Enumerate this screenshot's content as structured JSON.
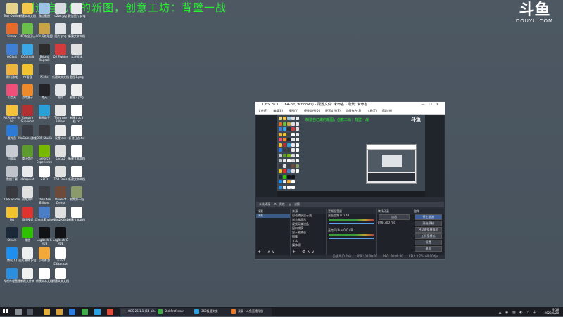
{
  "banner": "制造自己做的新图，创意工坊：背壁一战",
  "watermark": {
    "logo": "斗鱼",
    "site": "DOUYU.COM"
  },
  "desktop_icons": [
    {
      "label": "Tray Outline",
      "col": 0,
      "color": "#e8d38a"
    },
    {
      "label": "新建文本文档",
      "col": 1,
      "color": "#f4c84a"
    },
    {
      "label": "微信截图",
      "col": 2,
      "color": "#9cc3e6"
    },
    {
      "label": "u2bc.jpg",
      "col": 3,
      "color": "#d9dde2"
    },
    {
      "label": "微信图片.png",
      "col": 4,
      "color": "#e9eaec"
    },
    {
      "label": "Firefox",
      "col": 0,
      "color": "#e66a2c"
    },
    {
      "label": "360安全卫士",
      "col": 1,
      "color": "#6cc04a"
    },
    {
      "label": "LOL英雄联盟",
      "col": 2,
      "color": "#c9a34a"
    },
    {
      "label": "图片.png",
      "col": 3,
      "color": "#dfe3e7"
    },
    {
      "label": "新建文本文档",
      "col": 4,
      "color": "#e9eaec"
    },
    {
      "label": "QQ游戏",
      "col": 0,
      "color": "#3f7fd6"
    },
    {
      "label": "QQ浏览器",
      "col": 1,
      "color": "#3aa7e6"
    },
    {
      "label": "Bright Ragdoll",
      "col": 2,
      "color": "#2d2d2d"
    },
    {
      "label": "Q2 Fighter",
      "col": 3,
      "color": "#d23c3c"
    },
    {
      "label": "实况足球",
      "col": 4,
      "color": "#e0e0e0"
    },
    {
      "label": "腾讯游戏",
      "col": 0,
      "color": "#f0b43c"
    },
    {
      "label": "YY语音",
      "col": 1,
      "color": "#f2c230"
    },
    {
      "label": "Niche",
      "col": 2,
      "color": "#3a3f48"
    },
    {
      "label": "新建文本文档",
      "col": 3,
      "color": "#ffffff"
    },
    {
      "label": "截图1.png",
      "col": 4,
      "color": "#e8ecef"
    },
    {
      "label": "钉工具",
      "col": 0,
      "color": "#f04f7a"
    },
    {
      "label": "游戏盒子",
      "col": 1,
      "color": "#ef8a2a"
    },
    {
      "label": "冬天",
      "col": 2,
      "color": "#222428"
    },
    {
      "label": "图片",
      "col": 3,
      "color": "#e3e6e9"
    },
    {
      "label": "截图2.png",
      "col": 4,
      "color": "#f0f0f0"
    },
    {
      "label": "PotPlayer 64 bit",
      "col": 0,
      "color": "#f5c23a"
    },
    {
      "label": "Vampire Survivors",
      "col": 1,
      "color": "#b33030"
    },
    {
      "label": "截图助手",
      "col": 2,
      "color": "#2aa0d8"
    },
    {
      "label": "They Are Billions",
      "col": 3,
      "color": "#e6e6e6"
    },
    {
      "label": "新建文本文档.txt",
      "col": 4,
      "color": "#ffffff"
    },
    {
      "label": "夏令营",
      "col": 0,
      "color": "#2c7ad6"
    },
    {
      "label": "MaGame游戏",
      "col": 1,
      "color": "#3a3c44"
    },
    {
      "label": "OBS Studio",
      "col": 2,
      "color": "#383a40"
    },
    {
      "label": "设置.exe",
      "col": 3,
      "color": "#eaeaea"
    },
    {
      "label": "新建日志.txt",
      "col": 4,
      "color": "#ffffff"
    },
    {
      "label": "回收站",
      "col": 0,
      "color": "#c8ccd2"
    },
    {
      "label": "腾讯会议",
      "col": 1,
      "color": "#5c9c2c"
    },
    {
      "label": "GeForce Experience",
      "col": 2,
      "color": "#76b900"
    },
    {
      "label": "CS:GO",
      "col": 3,
      "color": "#e0e0e0"
    },
    {
      "label": "新建文本文档",
      "col": 4,
      "color": "#ffffff"
    },
    {
      "label": "数据下载",
      "col": 0,
      "color": "#c0c4ca"
    },
    {
      "label": "datapoint",
      "col": 1,
      "color": "#e9eaec"
    },
    {
      "label": "21FR",
      "col": 2,
      "color": "#ffffff"
    },
    {
      "label": "TAB Tools",
      "col": 3,
      "color": "#e2e2e2"
    },
    {
      "label": "新建文本文档",
      "col": 4,
      "color": "#ffffff"
    },
    {
      "label": "OBS Studio",
      "col": 0,
      "color": "#383a40"
    },
    {
      "label": "视频文件",
      "col": 1,
      "color": "#e0e0e0"
    },
    {
      "label": "They Are Billions",
      "col": 2,
      "color": "#3d3f47"
    },
    {
      "label": "Dawn of Demo",
      "col": 3,
      "color": "#6d4a3a"
    },
    {
      "label": "视频第一段",
      "col": 4,
      "color": "#8a9a6a"
    },
    {
      "label": "QQ",
      "col": 0,
      "color": "#f2c12e"
    },
    {
      "label": "腾讯视频",
      "col": 1,
      "color": "#e0332f"
    },
    {
      "label": "Cheat Engine",
      "col": 2,
      "color": "#4c7ec7"
    },
    {
      "label": "NBA2K游戏",
      "col": 3,
      "color": "#e0e0e0"
    },
    {
      "label": "新建文本文档",
      "col": 4,
      "color": "#ffffff"
    },
    {
      "label": "Steam",
      "col": 0,
      "color": "#1b2838"
    },
    {
      "label": "微信",
      "col": 1,
      "color": "#2dc100"
    },
    {
      "label": "Logitech G HUB",
      "col": 2,
      "color": "#101215"
    },
    {
      "label": "Logitech G HUB",
      "col": 3,
      "color": "#101215"
    },
    {
      "label": "",
      "col": 4,
      "color": "transparent"
    },
    {
      "label": "腾讯QQ",
      "col": 0,
      "color": "#1e8ef0"
    },
    {
      "label": "图片编辑.png",
      "col": 1,
      "color": "#eceef0"
    },
    {
      "label": "小电影游",
      "col": 2,
      "color": "#f3a93a"
    },
    {
      "label": "Launch Editor.bat",
      "col": 3,
      "color": "#ffffff"
    },
    {
      "label": "",
      "col": 4,
      "color": "transparent"
    },
    {
      "label": "哔哩哔哩直播",
      "col": 0,
      "color": "#2a8fe0"
    },
    {
      "label": "新建文件夹",
      "col": 1,
      "color": "#f0f0f0"
    },
    {
      "label": "新建文本文档",
      "col": 2,
      "color": "#ffffff"
    },
    {
      "label": "新建文本文档",
      "col": 3,
      "color": "#ffffff"
    },
    {
      "label": "",
      "col": 4,
      "color": "transparent"
    }
  ],
  "obs": {
    "title": "OBS 26.1.1 (64-bit, windows) - 配置文件: 未命名 - 场景: 未命名",
    "menu": [
      "文件(F)",
      "编辑(E)",
      "视图(V)",
      "停靠部件(D)",
      "配置文件(P)",
      "场景集合(S)",
      "工具(T)",
      "帮助(H)"
    ],
    "preview_banner": "制造自己做的新图，创意工坊：背壁一战",
    "preview_watermark": "斗鱼",
    "no_source": "未选择源",
    "strip_props": "属性",
    "strip_filters": "滤镜",
    "scenes": {
      "header": "场景",
      "items": [
        "场景"
      ]
    },
    "sources": {
      "header": "来源",
      "items": [
        "自动捕获显示器",
        "浏览器显示",
        "视频采集设备",
        "窗口捕获",
        "显示器捕获",
        "图像",
        "文本",
        "媒体源"
      ]
    },
    "mixer": {
      "header": "音频混音器",
      "ch1": "桌面音频",
      "ch1_db": "0.0 dB",
      "ch2": "麦克风/Aux",
      "ch2_db": "0.0 dB"
    },
    "transitions": {
      "header": "转场动画",
      "type": "淡出",
      "duration_label": "时长",
      "duration": "300 ms"
    },
    "controls": {
      "header": "控件",
      "buttons": [
        "停止推流",
        "开始录制",
        "启动虚拟摄像机",
        "工作室模式",
        "设置",
        "退出"
      ]
    },
    "status": {
      "live": "LIVE: 00:00:00",
      "rec": "REC: 00:00:00",
      "cpu": "CPU: 3.7%, 60.00 fps",
      "dropped": "丢帧 0 (0.0%)"
    }
  },
  "taskbar": {
    "tasks": [
      "OBS 26.1.1 (64-bit...",
      "DiskProfessor",
      "360极速浏览",
      "录屏 - 斗鱼直播伴侣"
    ],
    "time": "9:18",
    "date": "2022/6/20"
  }
}
